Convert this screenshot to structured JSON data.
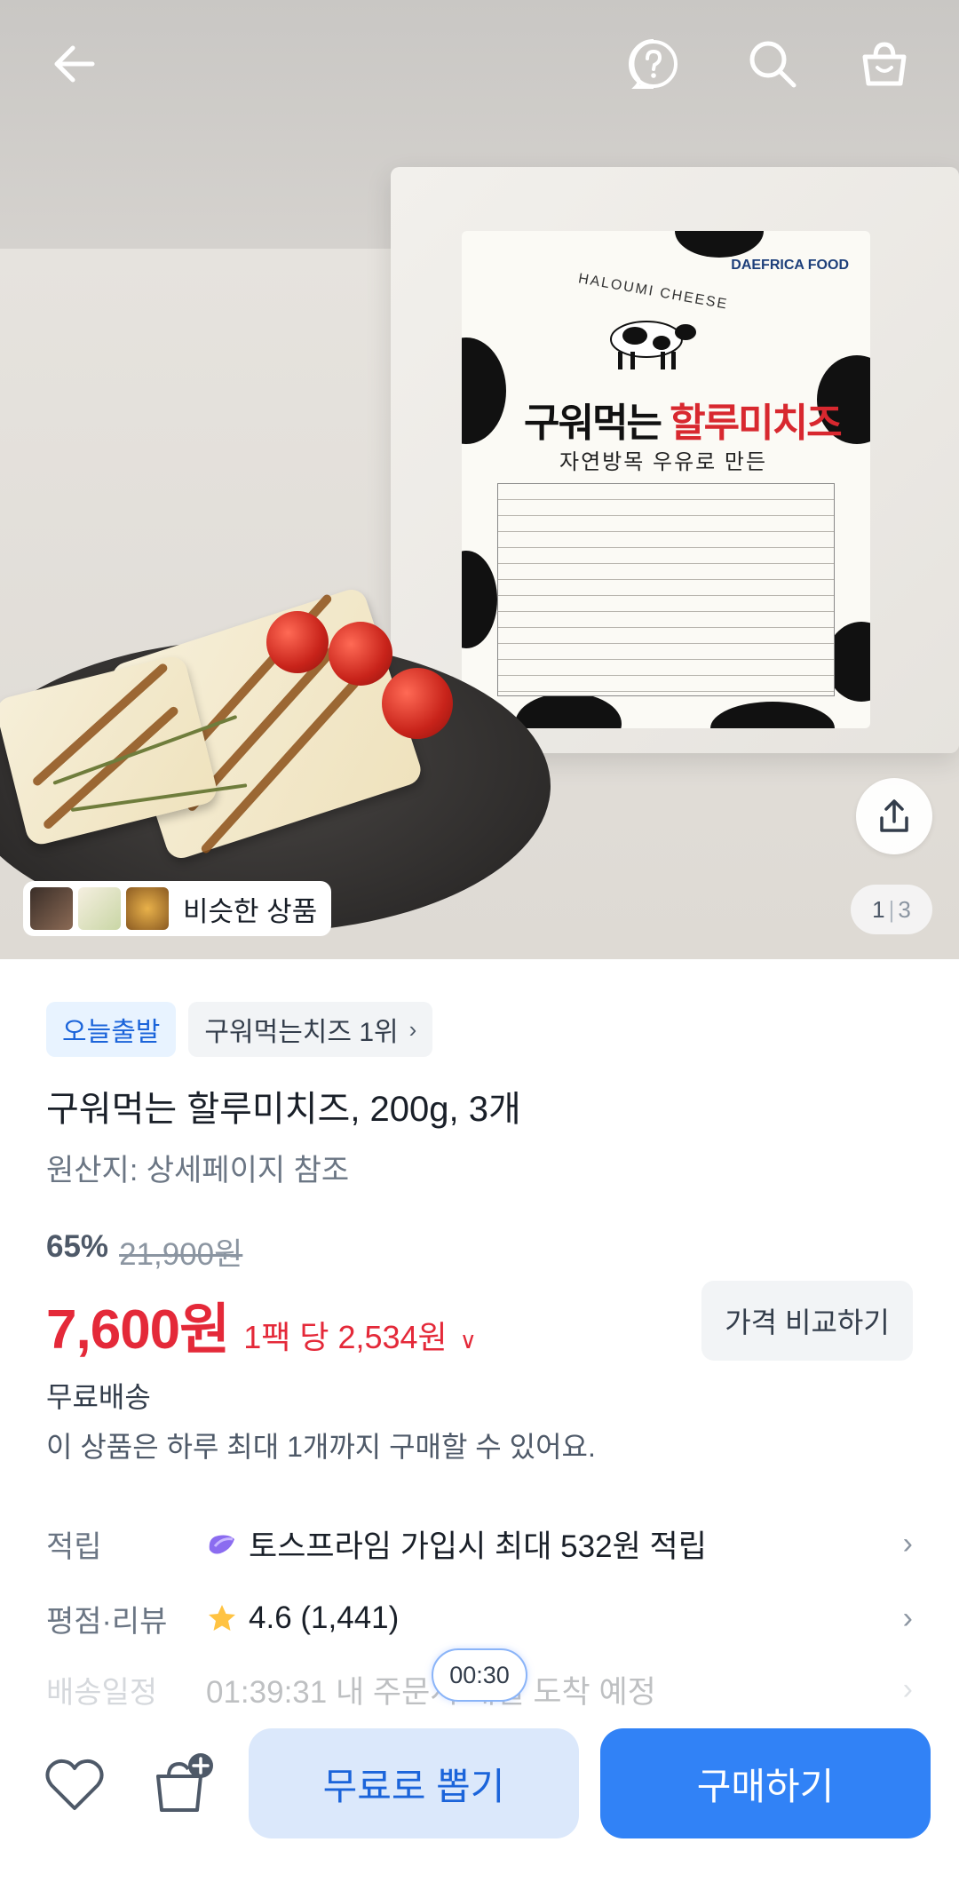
{
  "hero": {
    "package_title_part1": "구워먹는 ",
    "package_title_part2": "할루미치즈",
    "package_subtitle": "자연방목 우유로 만든",
    "package_brand": "DAEFRICA FOOD",
    "package_sub": "HALOUMI CHEESE",
    "page_current": "1",
    "page_total": "3",
    "similar_label": "비슷한 상품"
  },
  "nav": {
    "back_icon": "arrow-left-icon",
    "help_icon": "question-icon",
    "search_icon": "search-icon",
    "cart_icon": "shopping-bag-icon"
  },
  "product": {
    "badge_today": "오늘출발",
    "badge_rank": "구워먹는치즈 1위",
    "name": "구워먹는 할루미치즈, 200g, 3개",
    "origin": "원산지: 상세페이지 참조",
    "discount_pct": "65%",
    "original_price": "21,900원",
    "price": "7,600원",
    "unit_price": "1팩 당 2,534원",
    "compare_label": "가격 비교하기",
    "shipping": "무료배송",
    "purchase_limit": "이 상품은 하루 최대 1개까지 구매할 수 있어요."
  },
  "rows": {
    "points_key": "적립",
    "points_val": "토스프라임 가입시 최대 532원 적립",
    "rating_key": "평점·리뷰",
    "rating_val": "4.6 (1,441)",
    "delivery_key": "배송일정",
    "delivery_val": "01:39:31 내 주문시 내일 도착 예정"
  },
  "timer": "00:30",
  "bottom": {
    "free_label": "무료로 뽑기",
    "buy_label": "구매하기"
  },
  "colors": {
    "accent_blue": "#3182f6",
    "price_red": "#e42939",
    "star": "#ffc342"
  }
}
